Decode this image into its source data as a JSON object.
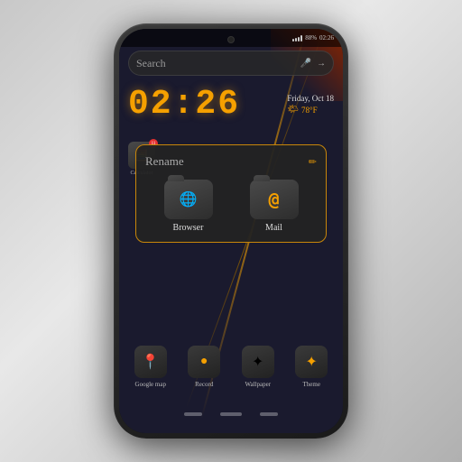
{
  "phone": {
    "statusBar": {
      "signal": "88%",
      "battery": "88%",
      "time": "02:26"
    },
    "search": {
      "placeholder": "Search",
      "micIcon": "🎤",
      "arrowIcon": "→"
    },
    "clock": {
      "time": "02:26",
      "date": "Friday, Oct 18",
      "temperature": "78°F",
      "weatherIcon": "🌤"
    },
    "renameDialog": {
      "title": "Rename",
      "editIcon": "✏",
      "folders": [
        {
          "name": "Browser",
          "symbol": "🌐"
        },
        {
          "name": "Mail",
          "symbol": "@"
        }
      ]
    },
    "bottomApps": [
      {
        "name": "Google map",
        "symbol": "📍",
        "badge": null
      },
      {
        "name": "Record",
        "symbol": "⏺",
        "badge": null
      },
      {
        "name": "Wallpaper",
        "symbol": "🌟",
        "badge": null
      },
      {
        "name": "Theme",
        "symbol": "✦",
        "badge": null
      }
    ],
    "topLeftApp": {
      "name": "Calculator",
      "symbol": "🧮",
      "badge": "11"
    }
  }
}
